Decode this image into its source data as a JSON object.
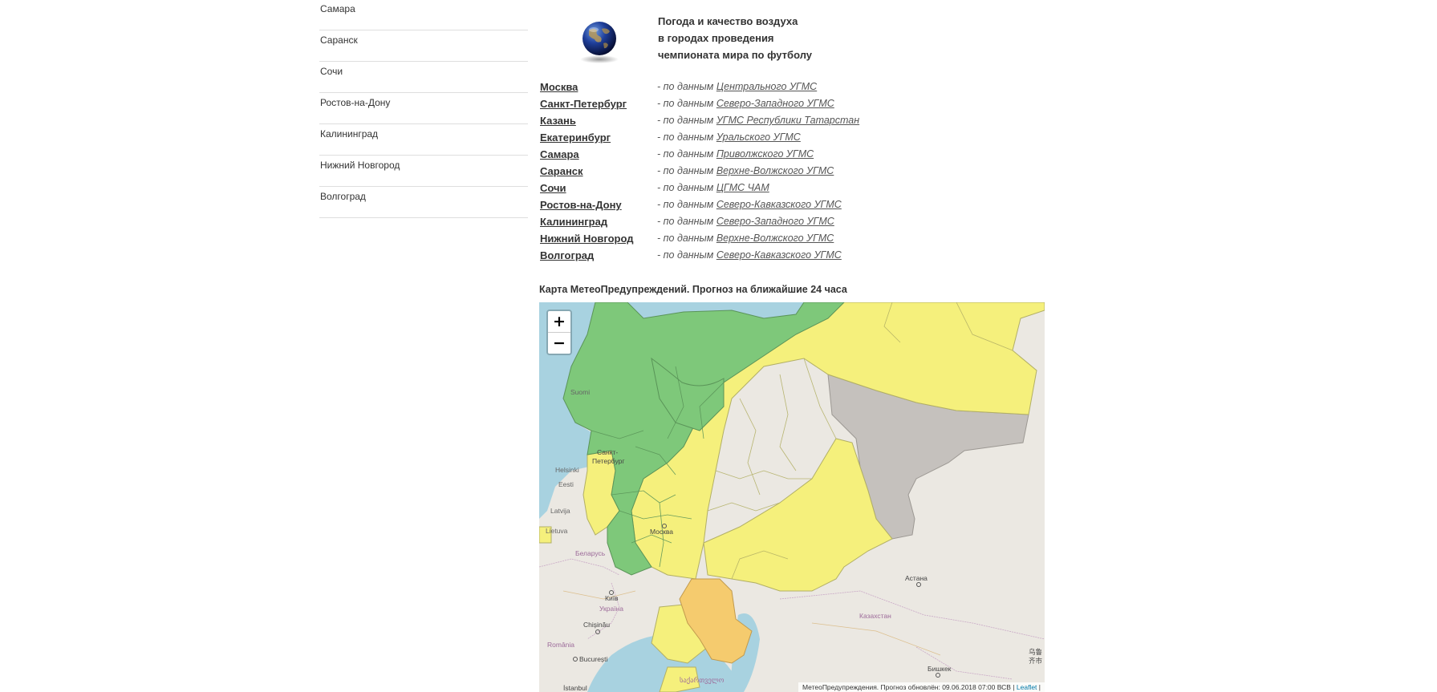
{
  "sidebar": {
    "items": [
      {
        "label": "Самара"
      },
      {
        "label": "Саранск"
      },
      {
        "label": "Сочи"
      },
      {
        "label": "Ростов-на-Дону"
      },
      {
        "label": "Калининград"
      },
      {
        "label": "Нижний Новгород"
      },
      {
        "label": "Волгоград"
      }
    ]
  },
  "header": {
    "icon": "globe-icon",
    "lines": [
      "Погода и качество воздуха",
      "в городах проведения",
      "чемпионата мира по футболу"
    ]
  },
  "cities": [
    {
      "name": "Москва",
      "prefix": "- по данным ",
      "source": "Центрального УГМС"
    },
    {
      "name": "Санкт-Петербург",
      "prefix": "- по данным ",
      "source": "Северо-Западного УГМС"
    },
    {
      "name": "Казань",
      "prefix": "- по данным ",
      "source": "УГМС Республики Татарстан"
    },
    {
      "name": "Екатеринбург",
      "prefix": "- по данным ",
      "source": "Уральского УГМС"
    },
    {
      "name": "Самара",
      "prefix": "- по данным ",
      "source": "Приволжского УГМС"
    },
    {
      "name": "Саранск",
      "prefix": "- по данным ",
      "source": "Верхне-Волжского УГМС"
    },
    {
      "name": "Сочи",
      "prefix": "- по данным ",
      "source": "ЦГМС ЧАМ"
    },
    {
      "name": "Ростов-на-Дону",
      "prefix": "- по данным ",
      "source": "Северо-Кавказского УГМС"
    },
    {
      "name": "Калининград",
      "prefix": "- по данным ",
      "source": "Северо-Западного УГМС"
    },
    {
      "name": "Нижний Новгород",
      "prefix": "- по данным ",
      "source": "Верхне-Волжского УГМС"
    },
    {
      "name": "Волгоград",
      "prefix": "- по данным ",
      "source": "Северо-Кавказского УГМС"
    }
  ],
  "map": {
    "title": "Карта МетеоПредупреждений. Прогноз на ближайшие 24 часа",
    "zoom_in": "+",
    "zoom_out": "−",
    "labels": {
      "suomi": "Suomi",
      "spb_1": "Санкт-",
      "spb_2": "Петербург",
      "helsinki": "Helsinki",
      "eesti": "Eesti",
      "latvija": "Latvija",
      "lietuva": "Lietuva",
      "moskva": "Москва",
      "belarus": "Беларусь",
      "kyiv": "Київ",
      "ukraina": "Україна",
      "chisinau": "Chișinău",
      "romania": "România",
      "bucuresti": "București",
      "istanbul": "İstanbul",
      "georgia": "საქართველო",
      "astana": "Астана",
      "kazakhstan": "Казахстан",
      "bishkek": "Бишкек",
      "urumqi_1": "乌鲁",
      "urumqi_2": "齐市"
    },
    "attribution_text": "МетеоПредупреждения. Прогноз обновлён: 09.06.2018 07:00 ВСВ",
    "attribution_sep": " | ",
    "attribution_link": "Leaflet",
    "attribution_end": " |",
    "colors": {
      "green": "#7ec87a",
      "yellow": "#f5f07c",
      "orange": "#f5cb6e",
      "gray": "#c5c1bd",
      "water": "#a8d2e0",
      "land": "#ebe8e2"
    }
  }
}
